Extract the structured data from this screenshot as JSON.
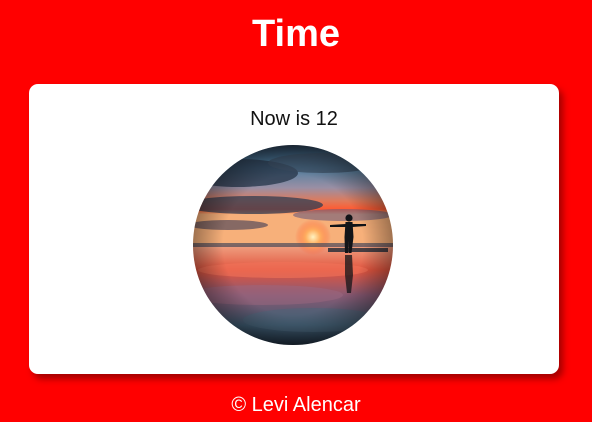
{
  "page": {
    "title": "Time",
    "background_color": "#ff0000"
  },
  "card": {
    "time_text": "Now is 12",
    "photo": {
      "semantic": "sunset-beach-silhouette-image",
      "shape": "circle"
    }
  },
  "footer": {
    "credit": "© Levi Alencar"
  }
}
